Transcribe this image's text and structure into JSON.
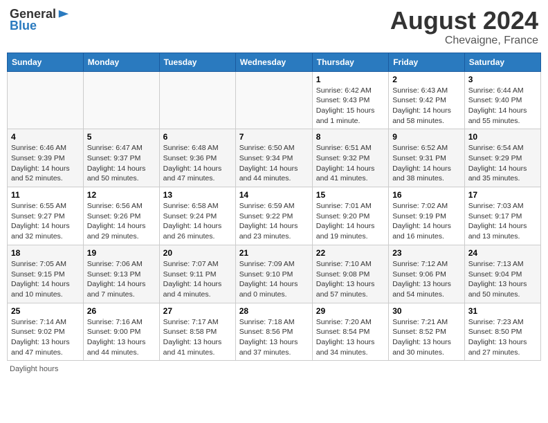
{
  "header": {
    "logo_general": "General",
    "logo_blue": "Blue",
    "month_year": "August 2024",
    "location": "Chevaigne, France"
  },
  "weekdays": [
    "Sunday",
    "Monday",
    "Tuesday",
    "Wednesday",
    "Thursday",
    "Friday",
    "Saturday"
  ],
  "footer": {
    "note": "Daylight hours"
  },
  "weeks": [
    {
      "days": [
        {
          "num": "",
          "info": ""
        },
        {
          "num": "",
          "info": ""
        },
        {
          "num": "",
          "info": ""
        },
        {
          "num": "",
          "info": ""
        },
        {
          "num": "1",
          "info": "Sunrise: 6:42 AM\nSunset: 9:43 PM\nDaylight: 15 hours\nand 1 minute."
        },
        {
          "num": "2",
          "info": "Sunrise: 6:43 AM\nSunset: 9:42 PM\nDaylight: 14 hours\nand 58 minutes."
        },
        {
          "num": "3",
          "info": "Sunrise: 6:44 AM\nSunset: 9:40 PM\nDaylight: 14 hours\nand 55 minutes."
        }
      ]
    },
    {
      "days": [
        {
          "num": "4",
          "info": "Sunrise: 6:46 AM\nSunset: 9:39 PM\nDaylight: 14 hours\nand 52 minutes."
        },
        {
          "num": "5",
          "info": "Sunrise: 6:47 AM\nSunset: 9:37 PM\nDaylight: 14 hours\nand 50 minutes."
        },
        {
          "num": "6",
          "info": "Sunrise: 6:48 AM\nSunset: 9:36 PM\nDaylight: 14 hours\nand 47 minutes."
        },
        {
          "num": "7",
          "info": "Sunrise: 6:50 AM\nSunset: 9:34 PM\nDaylight: 14 hours\nand 44 minutes."
        },
        {
          "num": "8",
          "info": "Sunrise: 6:51 AM\nSunset: 9:32 PM\nDaylight: 14 hours\nand 41 minutes."
        },
        {
          "num": "9",
          "info": "Sunrise: 6:52 AM\nSunset: 9:31 PM\nDaylight: 14 hours\nand 38 minutes."
        },
        {
          "num": "10",
          "info": "Sunrise: 6:54 AM\nSunset: 9:29 PM\nDaylight: 14 hours\nand 35 minutes."
        }
      ]
    },
    {
      "days": [
        {
          "num": "11",
          "info": "Sunrise: 6:55 AM\nSunset: 9:27 PM\nDaylight: 14 hours\nand 32 minutes."
        },
        {
          "num": "12",
          "info": "Sunrise: 6:56 AM\nSunset: 9:26 PM\nDaylight: 14 hours\nand 29 minutes."
        },
        {
          "num": "13",
          "info": "Sunrise: 6:58 AM\nSunset: 9:24 PM\nDaylight: 14 hours\nand 26 minutes."
        },
        {
          "num": "14",
          "info": "Sunrise: 6:59 AM\nSunset: 9:22 PM\nDaylight: 14 hours\nand 23 minutes."
        },
        {
          "num": "15",
          "info": "Sunrise: 7:01 AM\nSunset: 9:20 PM\nDaylight: 14 hours\nand 19 minutes."
        },
        {
          "num": "16",
          "info": "Sunrise: 7:02 AM\nSunset: 9:19 PM\nDaylight: 14 hours\nand 16 minutes."
        },
        {
          "num": "17",
          "info": "Sunrise: 7:03 AM\nSunset: 9:17 PM\nDaylight: 14 hours\nand 13 minutes."
        }
      ]
    },
    {
      "days": [
        {
          "num": "18",
          "info": "Sunrise: 7:05 AM\nSunset: 9:15 PM\nDaylight: 14 hours\nand 10 minutes."
        },
        {
          "num": "19",
          "info": "Sunrise: 7:06 AM\nSunset: 9:13 PM\nDaylight: 14 hours\nand 7 minutes."
        },
        {
          "num": "20",
          "info": "Sunrise: 7:07 AM\nSunset: 9:11 PM\nDaylight: 14 hours\nand 4 minutes."
        },
        {
          "num": "21",
          "info": "Sunrise: 7:09 AM\nSunset: 9:10 PM\nDaylight: 14 hours\nand 0 minutes."
        },
        {
          "num": "22",
          "info": "Sunrise: 7:10 AM\nSunset: 9:08 PM\nDaylight: 13 hours\nand 57 minutes."
        },
        {
          "num": "23",
          "info": "Sunrise: 7:12 AM\nSunset: 9:06 PM\nDaylight: 13 hours\nand 54 minutes."
        },
        {
          "num": "24",
          "info": "Sunrise: 7:13 AM\nSunset: 9:04 PM\nDaylight: 13 hours\nand 50 minutes."
        }
      ]
    },
    {
      "days": [
        {
          "num": "25",
          "info": "Sunrise: 7:14 AM\nSunset: 9:02 PM\nDaylight: 13 hours\nand 47 minutes."
        },
        {
          "num": "26",
          "info": "Sunrise: 7:16 AM\nSunset: 9:00 PM\nDaylight: 13 hours\nand 44 minutes."
        },
        {
          "num": "27",
          "info": "Sunrise: 7:17 AM\nSunset: 8:58 PM\nDaylight: 13 hours\nand 41 minutes."
        },
        {
          "num": "28",
          "info": "Sunrise: 7:18 AM\nSunset: 8:56 PM\nDaylight: 13 hours\nand 37 minutes."
        },
        {
          "num": "29",
          "info": "Sunrise: 7:20 AM\nSunset: 8:54 PM\nDaylight: 13 hours\nand 34 minutes."
        },
        {
          "num": "30",
          "info": "Sunrise: 7:21 AM\nSunset: 8:52 PM\nDaylight: 13 hours\nand 30 minutes."
        },
        {
          "num": "31",
          "info": "Sunrise: 7:23 AM\nSunset: 8:50 PM\nDaylight: 13 hours\nand 27 minutes."
        }
      ]
    }
  ]
}
